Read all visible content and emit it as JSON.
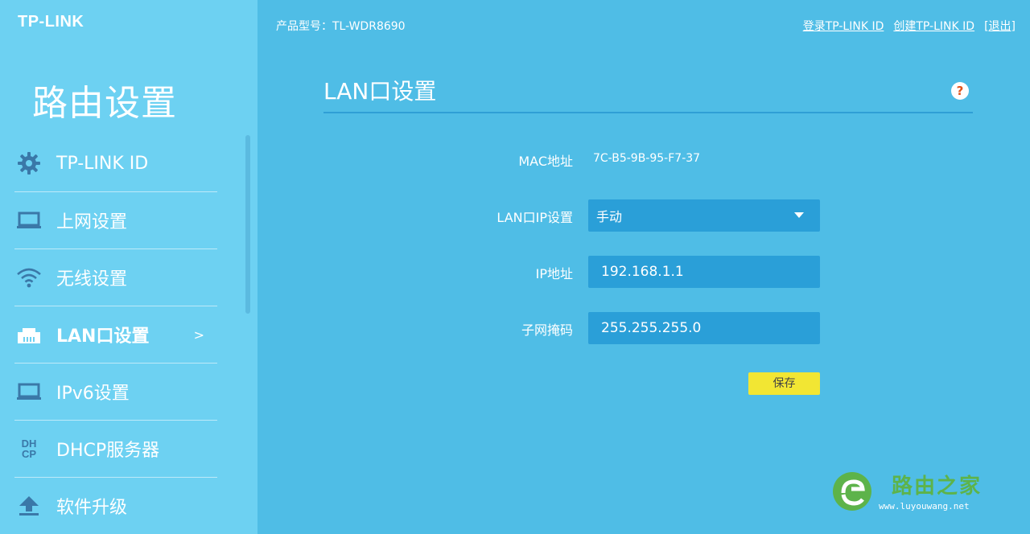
{
  "header": {
    "brand_logo": "TP-LINK",
    "model_label": "产品型号：TL-WDR8690",
    "links": [
      {
        "label": "登录TP-LINK ID"
      },
      {
        "label": "创建TP-LINK ID"
      },
      {
        "label": "[退出]"
      }
    ]
  },
  "sidebar": {
    "title": "路由设置",
    "items": [
      {
        "label": "TP-LINK ID",
        "icon": "gear-icon"
      },
      {
        "label": "上网设置",
        "icon": "laptop-icon"
      },
      {
        "label": "无线设置",
        "icon": "wifi-icon"
      },
      {
        "label": "LAN口设置",
        "icon": "lan-port-icon",
        "active": true,
        "chevron": ">"
      },
      {
        "label": "IPv6设置",
        "icon": "laptop-icon"
      },
      {
        "label": "DHCP服务器",
        "icon": "dhcp-icon",
        "icon_text": "DH CP"
      },
      {
        "label": "软件升级",
        "icon": "upload-icon"
      }
    ]
  },
  "main": {
    "title": "LAN口设置",
    "help_label": "?",
    "form": {
      "mac_label": "MAC地址",
      "mac_value": "7C-B5-9B-95-F7-37",
      "lan_ip_mode_label": "LAN口IP设置",
      "lan_ip_mode_value": "手动",
      "ip_label": "IP地址",
      "ip_value": "192.168.1.1",
      "mask_label": "子网掩码",
      "mask_value": "255.255.255.0",
      "save_label": "保存"
    }
  },
  "watermark": {
    "text": "路由之家",
    "url": "www.luyouwang.net"
  },
  "colors": {
    "page_bg": "#4fbde6",
    "sidebar_bg": "#6dd1f2",
    "field_bg": "#2a9fd8",
    "save_button": "#f2e633",
    "help_icon": "#e1541c",
    "icon_dark": "#3a78a8"
  }
}
